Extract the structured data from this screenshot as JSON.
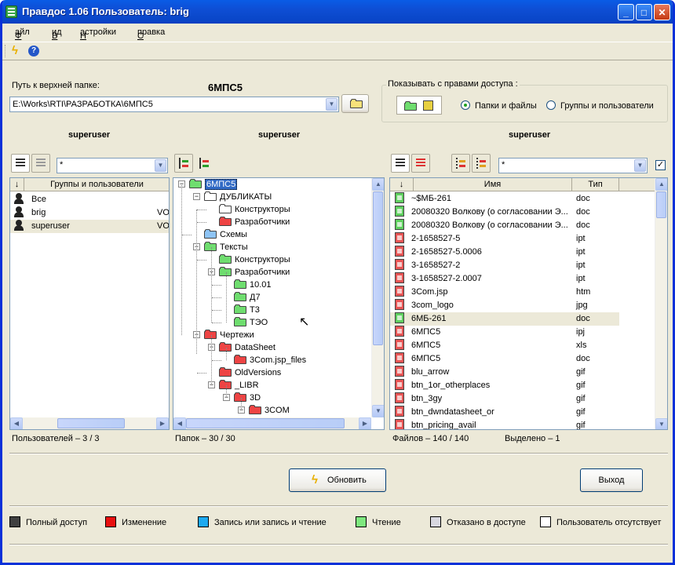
{
  "window": {
    "title": "Правдос 1.06  Пользователь: brig"
  },
  "menu": [
    "Файл",
    "Вид",
    "Настройки",
    "Справка"
  ],
  "path": {
    "label": "Путь к верхней папке:",
    "folder_name": "6МПС5",
    "value": "E:\\Works\\RTI\\РАЗРАБОТКА\\6МПС5"
  },
  "access": {
    "group_label": "Показывать с правами доступа :",
    "option_files": "Папки и файлы",
    "option_groups": "Группы и пользователи",
    "selected": "Папки и файлы"
  },
  "columns": {
    "left_user": "superuser",
    "mid_user": "superuser",
    "right_user": "superuser"
  },
  "left": {
    "filter": "*",
    "sort_arrow": "↓",
    "header": "Группы и пользователи",
    "rows": [
      {
        "name": "Все",
        "access": ""
      },
      {
        "name": "brig",
        "access": "VO"
      },
      {
        "name": "superuser",
        "access": "VO"
      }
    ],
    "status": "Пользователей – 3 / 3"
  },
  "tree": {
    "nodes": [
      {
        "label": "6МПС5",
        "level": 0,
        "color": "green",
        "toggle": "-"
      },
      {
        "label": "ДУБЛИКАТЫ",
        "level": 1,
        "color": "white",
        "toggle": "-"
      },
      {
        "label": "Конструкторы",
        "level": 2,
        "color": "white",
        "toggle": ""
      },
      {
        "label": "Разработчики",
        "level": 2,
        "color": "red",
        "toggle": ""
      },
      {
        "label": "Схемы",
        "level": 1,
        "color": "blue",
        "toggle": ""
      },
      {
        "label": "Тексты",
        "level": 1,
        "color": "green",
        "toggle": "-"
      },
      {
        "label": "Конструкторы",
        "level": 2,
        "color": "green",
        "toggle": ""
      },
      {
        "label": "Разработчики",
        "level": 2,
        "color": "green",
        "toggle": "-"
      },
      {
        "label": "10.01",
        "level": 3,
        "color": "green",
        "toggle": ""
      },
      {
        "label": "Д7",
        "level": 3,
        "color": "green",
        "toggle": ""
      },
      {
        "label": "Т3",
        "level": 3,
        "color": "green",
        "toggle": ""
      },
      {
        "label": "ТЭО",
        "level": 3,
        "color": "green",
        "toggle": ""
      },
      {
        "label": "Чертежи",
        "level": 1,
        "color": "red",
        "toggle": "-"
      },
      {
        "label": "DataSheet",
        "level": 2,
        "color": "red",
        "toggle": "-"
      },
      {
        "label": "3Com.jsp_files",
        "level": 3,
        "color": "red",
        "toggle": ""
      },
      {
        "label": "OldVersions",
        "level": 2,
        "color": "red",
        "toggle": ""
      },
      {
        "label": "_LIBR",
        "level": 2,
        "color": "red",
        "toggle": "-"
      },
      {
        "label": "3D",
        "level": 3,
        "color": "red",
        "toggle": "-"
      },
      {
        "label": "3COM",
        "level": 4,
        "color": "red",
        "toggle": "-"
      }
    ],
    "status": "Папок – 30 / 30"
  },
  "files": {
    "filter": "*",
    "sort_arrow": "↓",
    "col_name": "Имя",
    "col_type": "Тип",
    "rows": [
      {
        "name": "~$МБ-261",
        "type": "doc",
        "color": "green"
      },
      {
        "name": "20080320 Волкову (о согласовании Э...",
        "type": "doc",
        "color": "green"
      },
      {
        "name": "20080320 Волкову (о согласовании Э...",
        "type": "doc",
        "color": "green"
      },
      {
        "name": "2-1658527-5",
        "type": "ipt",
        "color": "red"
      },
      {
        "name": "2-1658527-5.0006",
        "type": "ipt",
        "color": "red"
      },
      {
        "name": "3-1658527-2",
        "type": "ipt",
        "color": "red"
      },
      {
        "name": "3-1658527-2.0007",
        "type": "ipt",
        "color": "red"
      },
      {
        "name": "3Com.jsp",
        "type": "htm",
        "color": "red"
      },
      {
        "name": "3com_logo",
        "type": "jpg",
        "color": "red"
      },
      {
        "name": "6МБ-261",
        "type": "doc",
        "color": "green"
      },
      {
        "name": "6МПС5",
        "type": "ipj",
        "color": "red"
      },
      {
        "name": "6МПС5",
        "type": "xls",
        "color": "red"
      },
      {
        "name": "6МПС5",
        "type": "doc",
        "color": "red"
      },
      {
        "name": "blu_arrow",
        "type": "gif",
        "color": "red"
      },
      {
        "name": "btn_1or_otherplaces",
        "type": "gif",
        "color": "red"
      },
      {
        "name": "btn_3gy",
        "type": "gif",
        "color": "red"
      },
      {
        "name": "btn_dwndatasheet_or",
        "type": "gif",
        "color": "red"
      },
      {
        "name": "btn_pricing_avail",
        "type": "gif",
        "color": "red"
      }
    ],
    "status_files": "Файлов – 140 / 140",
    "status_selected": "Выделено – 1",
    "checked": true
  },
  "buttons": {
    "refresh": "Обновить",
    "exit": "Выход"
  },
  "legend": [
    {
      "label": "Полный доступ",
      "color": "#404040"
    },
    {
      "label": "Изменение",
      "color": "#e81010"
    },
    {
      "label": "Запись или запись и чтение",
      "color": "#1eaaf0"
    },
    {
      "label": "Чтение",
      "color": "#7ee87e"
    },
    {
      "label": "Отказано в доступе",
      "color": "#d8d8e0"
    },
    {
      "label": "Пользователь отсутствует",
      "color": "#ffffff"
    }
  ]
}
